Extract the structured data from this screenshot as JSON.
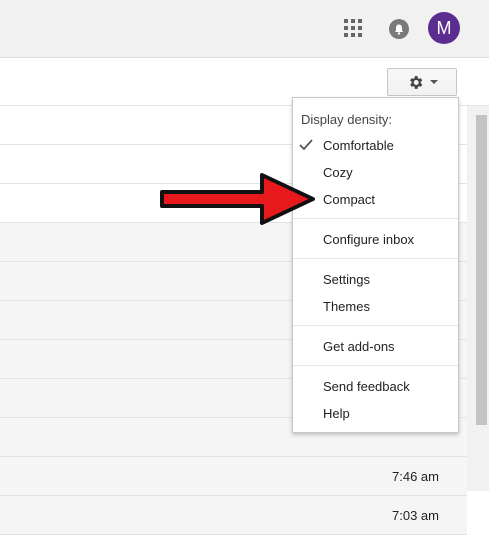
{
  "header": {
    "avatar_letter": "M",
    "icons": [
      "apps-grid-icon",
      "notifications-bell-icon"
    ]
  },
  "toolbar": {
    "settings_icon": "gear-icon"
  },
  "menu": {
    "header": "Display density:",
    "density_options": [
      {
        "label": "Comfortable",
        "checked": true
      },
      {
        "label": "Cozy",
        "checked": false
      },
      {
        "label": "Compact",
        "checked": false
      }
    ],
    "configure_inbox": "Configure inbox",
    "settings": "Settings",
    "themes": "Themes",
    "get_addons": "Get add-ons",
    "send_feedback": "Send feedback",
    "help": "Help"
  },
  "mail_list": {
    "times": [
      "7:46 am",
      "7:03 am"
    ]
  },
  "annotation": {
    "arrow_color": "#e8191c",
    "arrow_target": "Compact"
  },
  "colors": {
    "avatar_bg": "#5c2d91",
    "topbar_bg": "#f1f1f1"
  }
}
